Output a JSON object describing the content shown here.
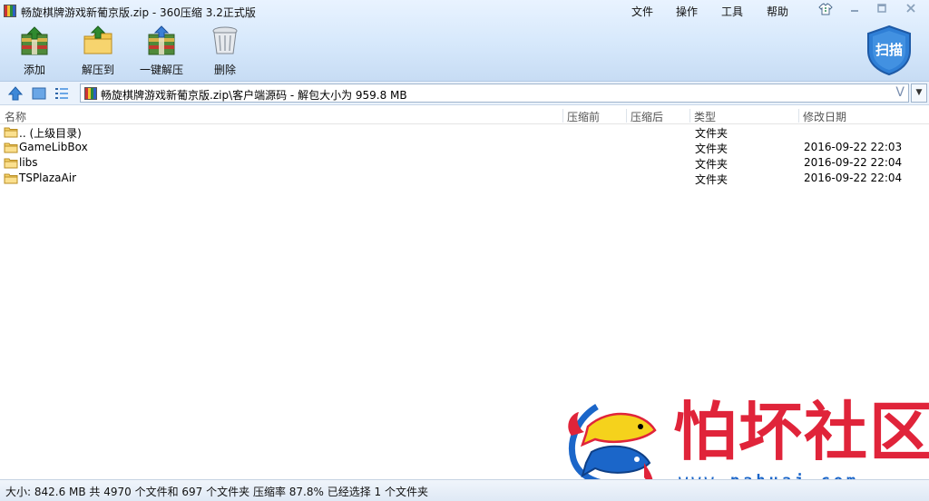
{
  "window": {
    "title": "畅旋棋牌游戏新葡京版.zip - 360压缩 3.2正式版",
    "menus": [
      "文件",
      "操作",
      "工具",
      "帮助"
    ]
  },
  "toolbar": {
    "add": "添加",
    "extract_to": "解压到",
    "one_click_extract": "一键解压",
    "delete": "删除",
    "scan": "扫描"
  },
  "address": {
    "path": "畅旋棋牌游戏新葡京版.zip\\客户端源码 - 解包大小为 959.8 MB",
    "v_button": "V"
  },
  "columns": {
    "name": "名称",
    "compressed_before": "压缩前",
    "compressed_after": "压缩后",
    "type": "类型",
    "modified": "修改日期"
  },
  "rows": [
    {
      "name": ".. (上级目录)",
      "type": "文件夹",
      "date": ""
    },
    {
      "name": "GameLibBox",
      "type": "文件夹",
      "date": "2016-09-22 22:03"
    },
    {
      "name": "libs",
      "type": "文件夹",
      "date": "2016-09-22 22:04"
    },
    {
      "name": "TSPlazaAir",
      "type": "文件夹",
      "date": "2016-09-22 22:04"
    }
  ],
  "status": {
    "text": "大小: 842.6 MB 共 4970 个文件和 697 个文件夹 压缩率 87.8% 已经选择 1 个文件夹"
  },
  "watermark": {
    "name": "怕坏社区",
    "url": "www.pahuai.com"
  },
  "colors": {
    "accent": "#2f7fd6",
    "watermark_red": "#e0243a",
    "watermark_blue": "#1b66c9"
  }
}
